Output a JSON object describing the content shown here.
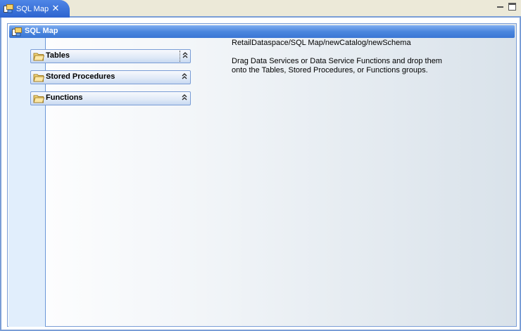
{
  "tab": {
    "label": "SQL Map",
    "close_glyph": "✕",
    "icon": "sql-map-icon"
  },
  "window_controls": {
    "minimize_icon": "minimize-icon",
    "maximize_icon": "maximize-icon"
  },
  "header": {
    "title": "SQL Map",
    "icon": "sql-map-icon"
  },
  "groups": [
    {
      "label": "Tables",
      "icon": "folder-icon",
      "toggle_glyph": "⌃",
      "expanded": true
    },
    {
      "label": "Stored Procedures",
      "icon": "folder-icon",
      "toggle_glyph": "⌃",
      "expanded": true
    },
    {
      "label": "Functions",
      "icon": "folder-icon",
      "toggle_glyph": "⌃",
      "expanded": true
    }
  ],
  "info": {
    "path": "RetailDataspace/SQL Map/newCatalog/newSchema",
    "description_line1": "Drag Data Services or Data Service Functions and drop them",
    "description_line2": "onto the Tables, Stored Procedures, or Functions groups."
  },
  "colors": {
    "tab_blue": "#3a72d8",
    "header_blue": "#4b86de",
    "border_blue": "#7a9dd6",
    "strip_blue": "#e1eefc"
  }
}
